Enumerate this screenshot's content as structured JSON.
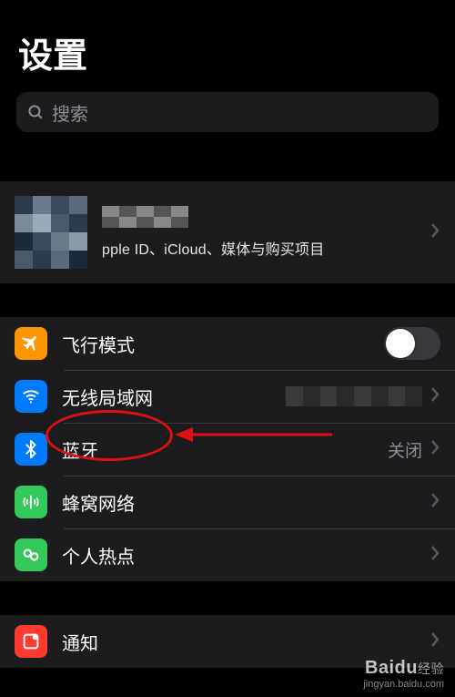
{
  "page": {
    "title": "设置"
  },
  "search": {
    "placeholder": "搜索"
  },
  "profile": {
    "subtitle": "pple ID、iCloud、媒体与购买项目"
  },
  "rows": {
    "airplane": {
      "label": "飞行模式"
    },
    "wifi": {
      "label": "无线局域网"
    },
    "bluetooth": {
      "label": "蓝牙",
      "value": "关闭"
    },
    "cellular": {
      "label": "蜂窝网络"
    },
    "hotspot": {
      "label": "个人热点"
    },
    "notifications": {
      "label": "通知"
    }
  },
  "watermark": {
    "brand": "Baidu",
    "sub": "经验",
    "url": "jingyan.baidu.com"
  },
  "colors": {
    "orange": "#ff9500",
    "blue": "#007aff",
    "green": "#34c759",
    "red": "#ff3b30"
  }
}
